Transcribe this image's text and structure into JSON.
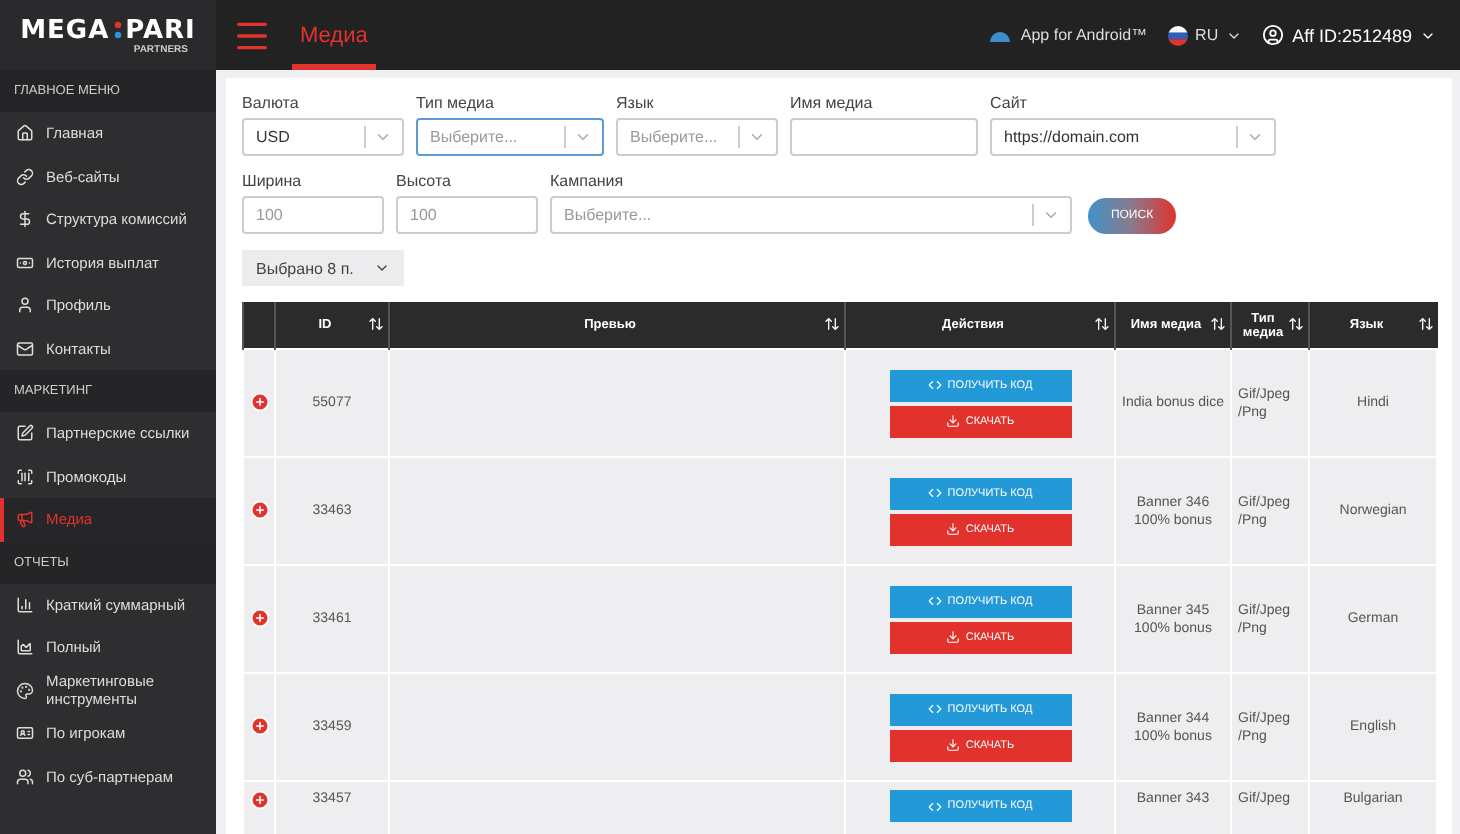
{
  "logo": {
    "left": "MEGA",
    "right": "PARI",
    "sub": "PARTNERS"
  },
  "header": {
    "title": "Медиа",
    "app_link": "App for Android™",
    "language": "RU",
    "account": "Aff ID:2512489"
  },
  "sidebar": {
    "sections": [
      {
        "title": "ГЛАВНОЕ МЕНЮ",
        "items": [
          {
            "label": "Главная",
            "selected": false
          },
          {
            "label": "Веб-сайты",
            "selected": false
          },
          {
            "label": "Структура комиссий",
            "selected": false
          },
          {
            "label": "История выплат",
            "selected": false
          },
          {
            "label": "Профиль",
            "selected": false
          },
          {
            "label": "Контакты",
            "selected": false
          }
        ]
      },
      {
        "title": "МАРКЕТИНГ",
        "items": [
          {
            "label": "Партнерские ссылки",
            "selected": false
          },
          {
            "label": "Промокоды",
            "selected": false
          },
          {
            "label": "Медиа",
            "selected": true
          }
        ]
      },
      {
        "title": "ОТЧЕТЫ",
        "items": [
          {
            "label": "Краткий суммарный",
            "selected": false
          },
          {
            "label": "Полный",
            "selected": false
          },
          {
            "label": "Маркетинговые инструменты",
            "selected": false
          },
          {
            "label": "По игрокам",
            "selected": false
          },
          {
            "label": "По суб-партнерам",
            "selected": false
          }
        ]
      }
    ]
  },
  "filters": [
    [
      {
        "label": "Валюта",
        "kind": "select",
        "value": "USD",
        "focused": false
      },
      {
        "label": "Тип медиа",
        "kind": "select",
        "placeholder": "Выберите...",
        "focused": true
      },
      {
        "label": "Язык",
        "kind": "select",
        "placeholder": "Выберите...",
        "focused": false
      },
      {
        "label": "Имя медиа",
        "kind": "text",
        "focused": false
      },
      {
        "label": "Сайт",
        "kind": "select",
        "value": "https://domain.com",
        "focused": false
      }
    ],
    [
      {
        "label": "Ширина",
        "kind": "text",
        "placeholder": "100",
        "focused": false
      },
      {
        "label": "Высота",
        "kind": "text",
        "placeholder": "100",
        "focused": false
      },
      {
        "label": "Кампания",
        "kind": "select",
        "placeholder": "Выберите...",
        "focused": false
      }
    ]
  ],
  "search_button": "ПОИСК",
  "columns_picker": "Выбрано 8 п.",
  "table": {
    "columns": [
      "ID",
      "Превью",
      "Действия",
      "Имя медиа",
      "Тип медиа",
      "Язык"
    ],
    "rows": [
      {
        "id": "55077",
        "get_code": "ПОЛУЧИТЬ КОД",
        "download": "СКАЧАТЬ",
        "media_name": "India bonus dice",
        "media_type": "Gif/Jpeg\n/Png",
        "language": "Hindi"
      },
      {
        "id": "33463",
        "get_code": "ПОЛУЧИТЬ КОД",
        "download": "СКАЧАТЬ",
        "media_name": "Banner 346\n100% bonus",
        "media_type": "Gif/Jpeg\n/Png",
        "language": "Norwegian"
      },
      {
        "id": "33461",
        "get_code": "ПОЛУЧИТЬ КОД",
        "download": "СКАЧАТЬ",
        "media_name": "Banner 345\n100% bonus",
        "media_type": "Gif/Jpeg\n/Png",
        "language": "German"
      },
      {
        "id": "33459",
        "get_code": "ПОЛУЧИТЬ КОД",
        "download": "СКАЧАТЬ",
        "media_name": "Banner 344\n100% bonus",
        "media_type": "Gif/Jpeg\n/Png",
        "language": "English"
      },
      {
        "id": "33457",
        "get_code": "ПОЛУЧИТЬ КОД",
        "media_name": "Banner 343",
        "media_type": "Gif/Jpeg",
        "language": "Bulgarian"
      }
    ]
  }
}
